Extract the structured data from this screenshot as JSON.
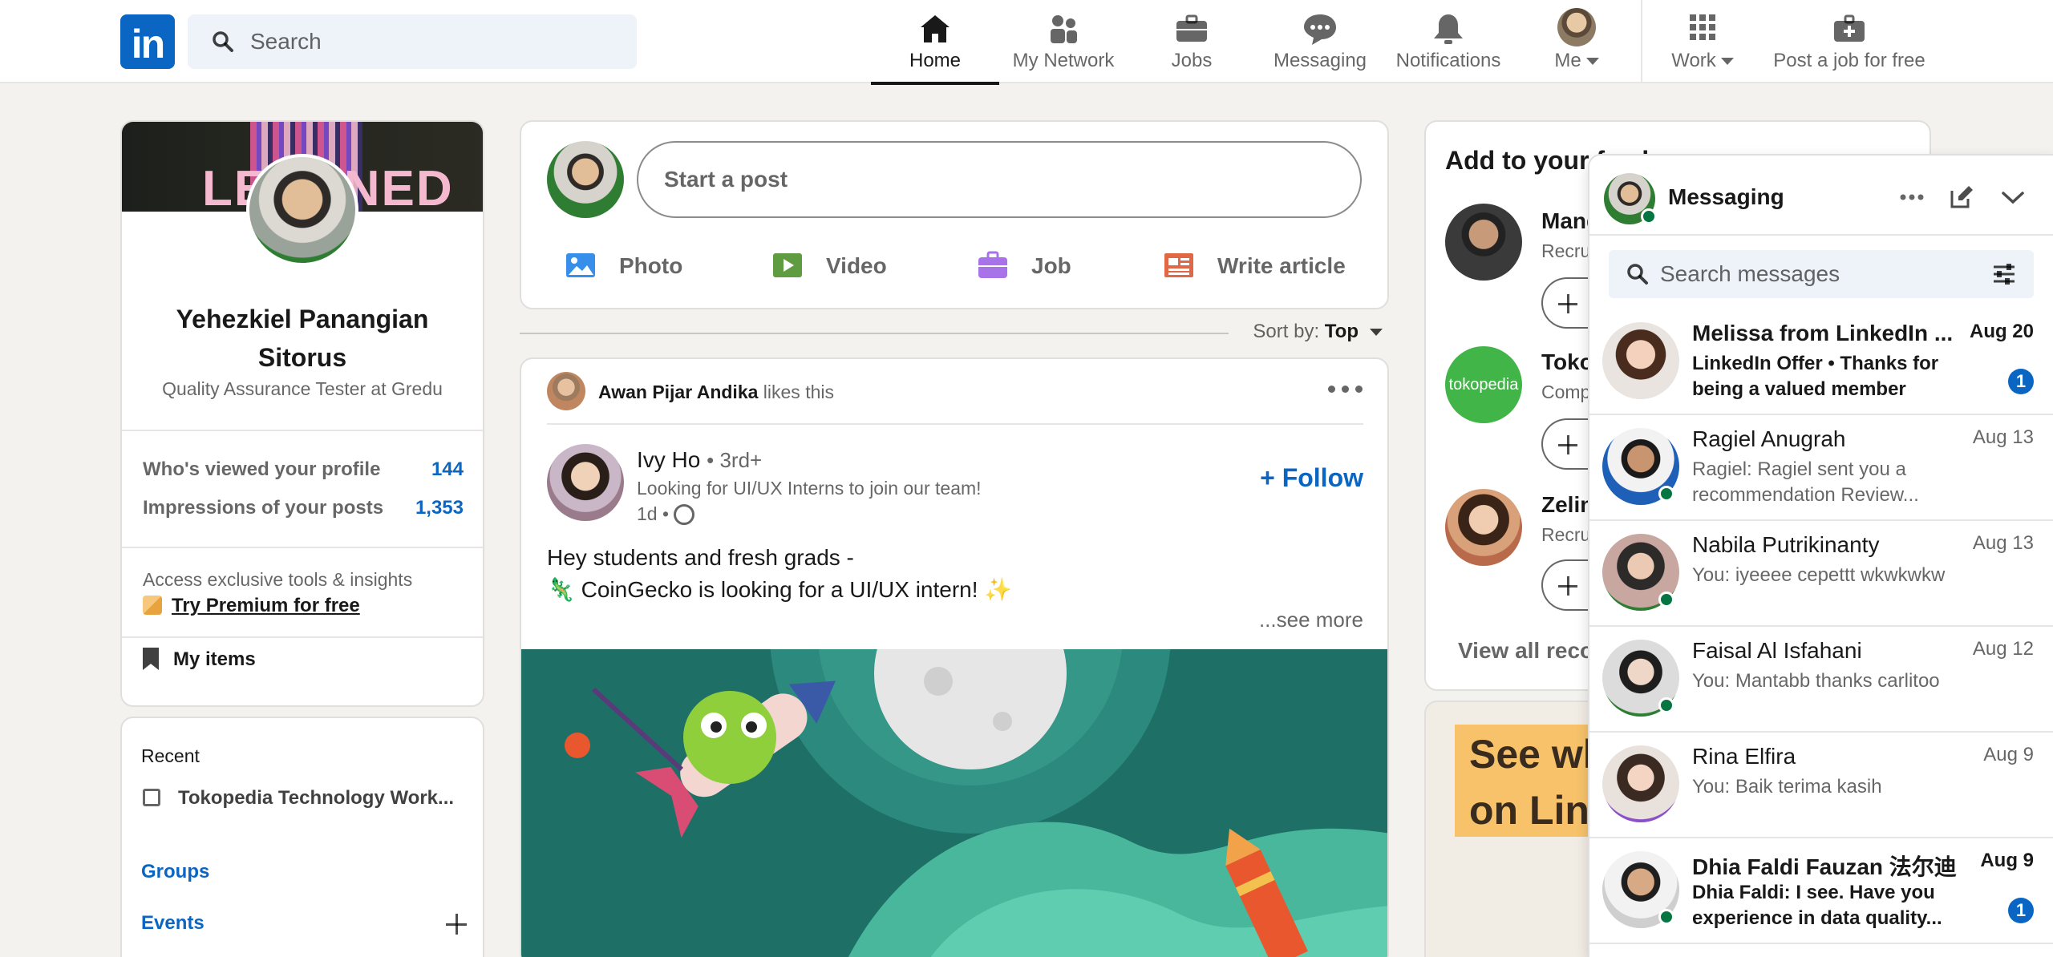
{
  "nav": {
    "search_placeholder": "Search",
    "items": [
      {
        "label": "Home",
        "icon": "home-icon"
      },
      {
        "label": "My Network",
        "icon": "network-icon"
      },
      {
        "label": "Jobs",
        "icon": "briefcase-icon"
      },
      {
        "label": "Messaging",
        "icon": "messaging-icon"
      },
      {
        "label": "Notifications",
        "icon": "bell-icon"
      },
      {
        "label": "Me",
        "icon": "avatar"
      },
      {
        "label": "Work",
        "icon": "grid-icon"
      },
      {
        "label": "Post a job for free",
        "icon": "briefcase-plus-icon"
      }
    ]
  },
  "profile": {
    "banner_text": "LEARNED",
    "name": "Yehezkiel Panangian Sitorus",
    "headline": "Quality Assurance Tester at Gredu",
    "stats": [
      {
        "label": "Who's viewed your profile",
        "value": "144"
      },
      {
        "label": "Impressions of your posts",
        "value": "1,353"
      }
    ],
    "premium_text": "Access exclusive tools & insights",
    "premium_link": "Try Premium for free",
    "my_items": "My items"
  },
  "recent": {
    "title": "Recent",
    "item": "Tokopedia Technology Work...",
    "groups": "Groups",
    "events": "Events"
  },
  "share": {
    "placeholder": "Start a post",
    "photo": "Photo",
    "video": "Video",
    "job": "Job",
    "article": "Write article"
  },
  "sort": {
    "label": "Sort by:",
    "value": "Top"
  },
  "post": {
    "liker": "Awan Pijar Andika",
    "liker_suffix": "likes this",
    "author": "Ivy Ho",
    "degree": "• 3rd+",
    "headline": "Looking for UI/UX Interns to join our team!",
    "time": "1d •",
    "follow": "+ Follow",
    "line1": "Hey students and fresh grads -",
    "line2": "🦎 CoinGecko is looking for a UI/UX intern! ✨",
    "see_more": "...see more"
  },
  "feed": {
    "title": "Add to your feed",
    "recs": [
      {
        "name": "Mang",
        "sub": "Recru"
      },
      {
        "name": "Toko",
        "sub": "Comp",
        "logo_text": "tokopedia"
      },
      {
        "name": "Zelin",
        "sub": "Recru"
      }
    ],
    "view_all": "View all reco"
  },
  "ad": {
    "line1": "See wh",
    "line2": "on Linke"
  },
  "messaging": {
    "title": "Messaging",
    "search_placeholder": "Search messages",
    "conversations": [
      {
        "name": "Melissa from LinkedIn ...",
        "date": "Aug 20",
        "preview": "LinkedIn Offer •  Thanks for being a valued member",
        "unread": "1"
      },
      {
        "name": "Ragiel Anugrah",
        "date": "Aug 13",
        "preview": "Ragiel: Ragiel sent you a recommendation Review..."
      },
      {
        "name": "Nabila Putrikinanty",
        "date": "Aug 13",
        "preview": "You: iyeeee cepettt wkwkwkw"
      },
      {
        "name": "Faisal Al Isfahani",
        "date": "Aug 12",
        "preview": "You: Mantabb thanks carlitoo"
      },
      {
        "name": "Rina Elfira",
        "date": "Aug 9",
        "preview": "You: Baik terima kasih"
      },
      {
        "name": "Dhia Faldi Fauzan 法尔迪",
        "date": "Aug 9",
        "preview": "Dhia Faldi: I see. Have you experience in data quality...",
        "unread": "1"
      }
    ]
  },
  "colors": {
    "brand": "#0a66c2",
    "background": "#f4f2ee",
    "online": "#057642"
  }
}
